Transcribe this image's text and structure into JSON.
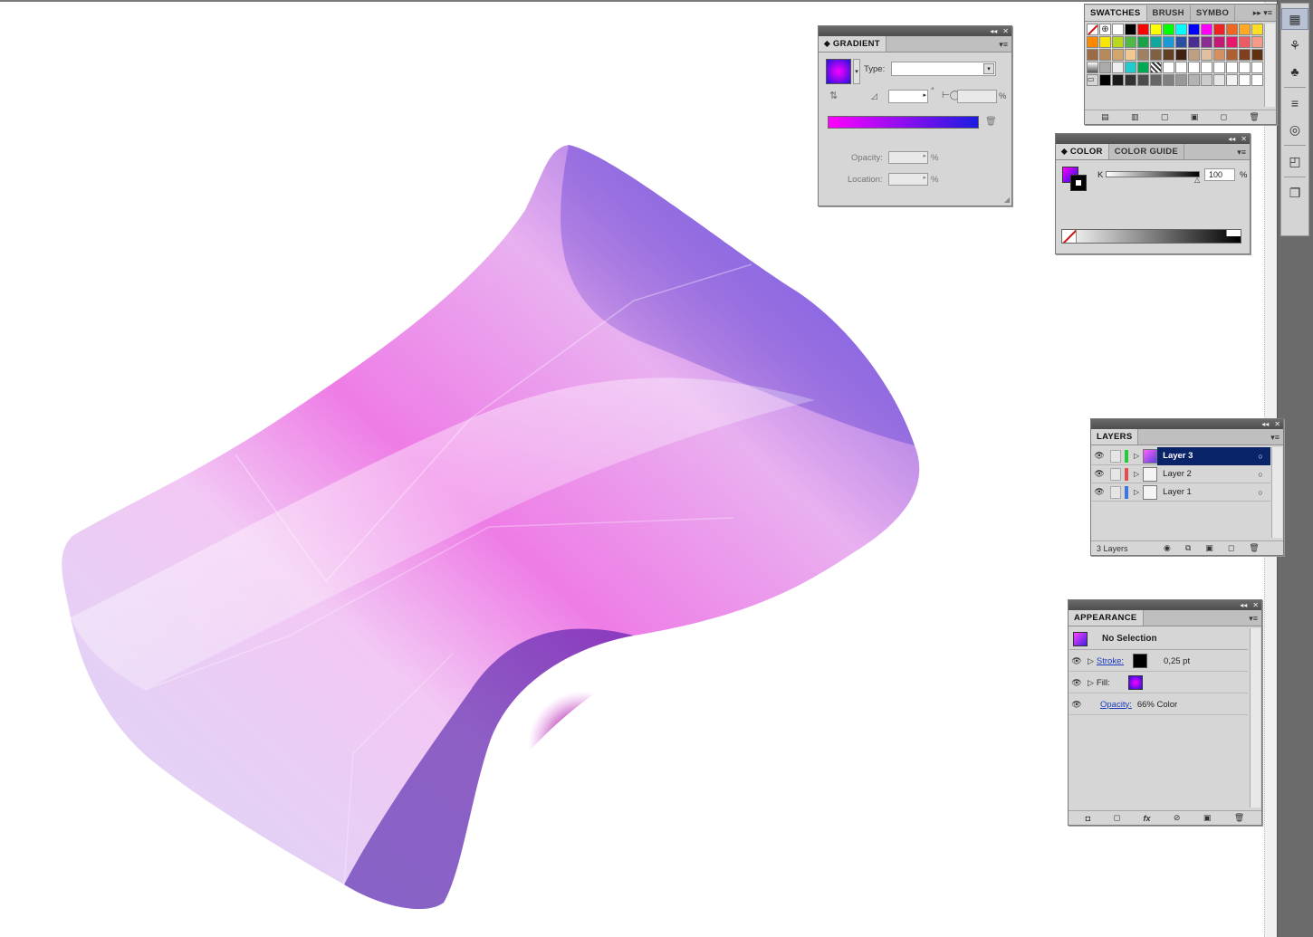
{
  "panels": {
    "gradient": {
      "tab": "GRADIENT",
      "type_label": "Type:",
      "degree_symbol": "°",
      "percent": "%",
      "opacity_label": "Opacity:",
      "location_label": "Location:"
    },
    "swatches": {
      "tabs": [
        "SWATCHES",
        "BRUSH",
        "SYMBO"
      ]
    },
    "color": {
      "tabs": [
        "COLOR",
        "COLOR GUIDE"
      ],
      "channel_label": "K",
      "channel_value": "100",
      "percent": "%"
    },
    "layers": {
      "tab": "LAYERS",
      "rows": [
        {
          "name": "Layer 3",
          "color": "#26c93a",
          "selected": true
        },
        {
          "name": "Layer 2",
          "color": "#e05050",
          "selected": false
        },
        {
          "name": "Layer 1",
          "color": "#3a78e0",
          "selected": false
        }
      ],
      "count_label": "3 Layers"
    },
    "appearance": {
      "tab": "APPEARANCE",
      "header": "No Selection",
      "stroke_label": "Stroke:",
      "stroke_value": "0,25 pt",
      "fill_label": "Fill:",
      "opacity_label": "Opacity:",
      "opacity_value": "66% Color"
    }
  },
  "colors": {
    "accent_selected_row": "#0a246a",
    "gradient_start": "#ff00ff",
    "gradient_end": "#1c1ce0"
  }
}
